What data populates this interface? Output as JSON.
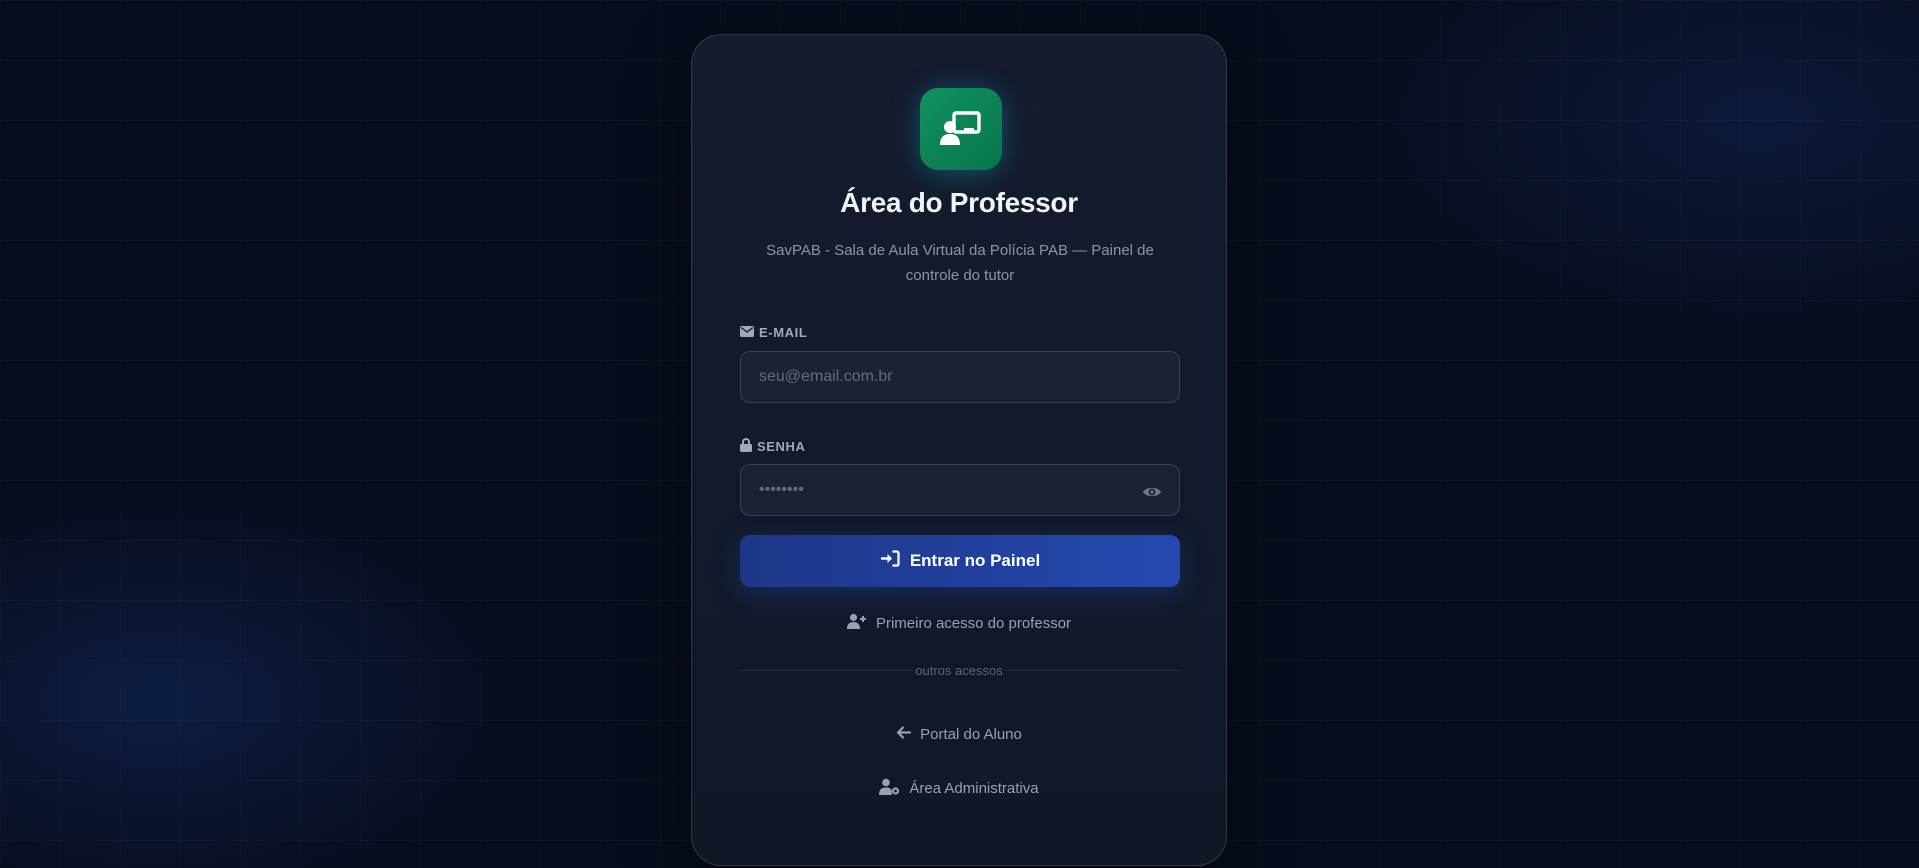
{
  "header": {
    "logo_icon": "chalkboard-teacher-icon",
    "title": "Área do Professor",
    "subtitle": "SavPAB - Sala de Aula Virtual da Polícia PAB — Painel de controle do tutor"
  },
  "form": {
    "email": {
      "label": "E-MAIL",
      "icon": "envelope-icon",
      "placeholder": "seu@email.com.br",
      "value": ""
    },
    "password": {
      "label": "SENHA",
      "icon": "lock-icon",
      "placeholder": "••••••••",
      "value": "",
      "toggle_icon": "eye-icon"
    },
    "submit": {
      "label": "Entrar no Painel",
      "icon": "sign-in-icon"
    },
    "first_access": {
      "label": "Primeiro acesso do professor",
      "icon": "user-plus-icon"
    }
  },
  "other_access": {
    "divider_label": "outros acessos",
    "links": [
      {
        "label": "Portal do Aluno",
        "icon": "arrow-left-icon"
      },
      {
        "label": "Área Administrativa",
        "icon": "user-gear-icon"
      }
    ]
  },
  "colors": {
    "background": "#070d1d",
    "card": "#131b2c",
    "accent_green": "#0f8a59",
    "primary_button": "#2449b1",
    "text_primary": "#f1f4f9",
    "text_muted": "#8c94a6"
  }
}
